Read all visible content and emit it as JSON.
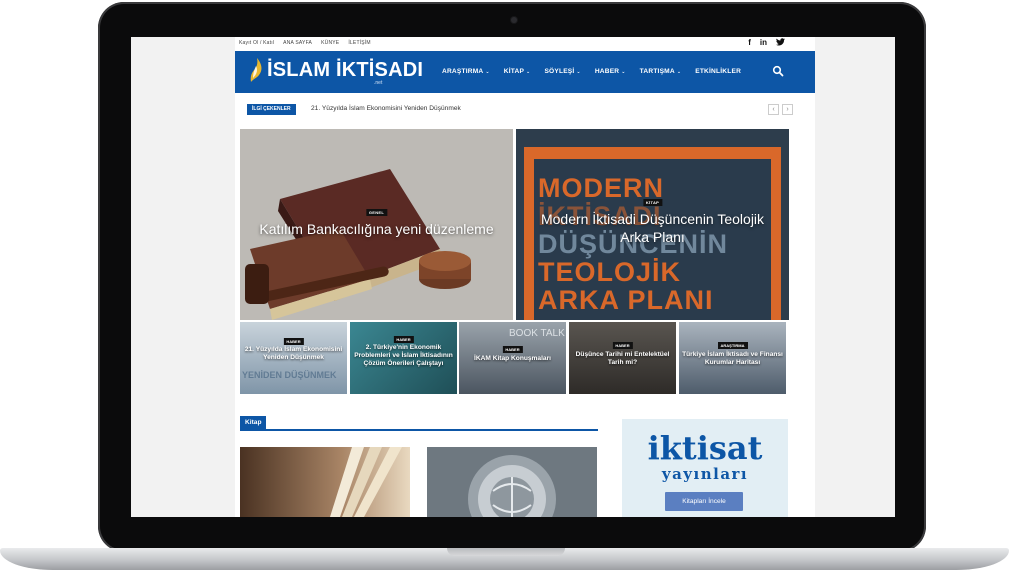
{
  "topbar": {
    "links": [
      "Kayıt Ol / Katıl",
      "ANA SAYFA",
      "KÜNYE",
      "İLETİŞİM"
    ],
    "social": [
      "f",
      "in",
      "t"
    ]
  },
  "header": {
    "logo_text": "İSLAM İKTİSADI",
    "logo_sub": ".net",
    "nav": [
      {
        "label": "ARAŞTIRMA",
        "dropdown": true
      },
      {
        "label": "KİTAP",
        "dropdown": true
      },
      {
        "label": "SÖYLEŞİ",
        "dropdown": true
      },
      {
        "label": "HABER",
        "dropdown": true
      },
      {
        "label": "TARTIŞMA",
        "dropdown": true
      },
      {
        "label": "ETKİNLİKLER",
        "dropdown": false
      }
    ],
    "brand_color": "#0d56a6"
  },
  "ticker": {
    "badge": "İLGİ ÇEKENLER",
    "text": "21. Yüzyılda İslam Ekonomisini Yeniden Düşünmek",
    "prev": "‹",
    "next": "›"
  },
  "hero": [
    {
      "category": "GENEL",
      "title": "Katılım Bankacılığına yeni düzenleme"
    },
    {
      "category": "KİTAP",
      "title": "Modern İktisadi Düşüncenin Teolojik Arka Planı",
      "poster_lines": [
        "MODERN",
        "İKTİSADİ",
        "DÜŞÜNCENİN",
        "TEOLOJİK",
        "ARKA PLANI"
      ]
    }
  ],
  "tiles": [
    {
      "category": "HABER",
      "title": "21. Yüzyılda İslam Ekonomisini Yeniden Düşünmek",
      "bg_text": "YENİDEN DÜŞÜNMEK"
    },
    {
      "category": "HABER",
      "title": "2. Türkiye'nin Ekonomik Problemleri ve İslam İktisadının Çözüm Önerileri Çalıştayı"
    },
    {
      "category": "HABER",
      "title": "İKAM Kitap Konuşmaları",
      "bg_text": "BOOK TALK"
    },
    {
      "category": "HABER",
      "title": "Düşünce Tarihi mi Entelektüel Tarih mi?"
    },
    {
      "category": "ARAŞTIRMA",
      "title": "Türkiye İslam İktisadı ve Finansı Kurumlar Haritası"
    }
  ],
  "section": {
    "title": "Kitap"
  },
  "ad": {
    "brand_line1": "iktisat",
    "brand_line2": "yayınları",
    "button": "Kitapları İncele"
  }
}
